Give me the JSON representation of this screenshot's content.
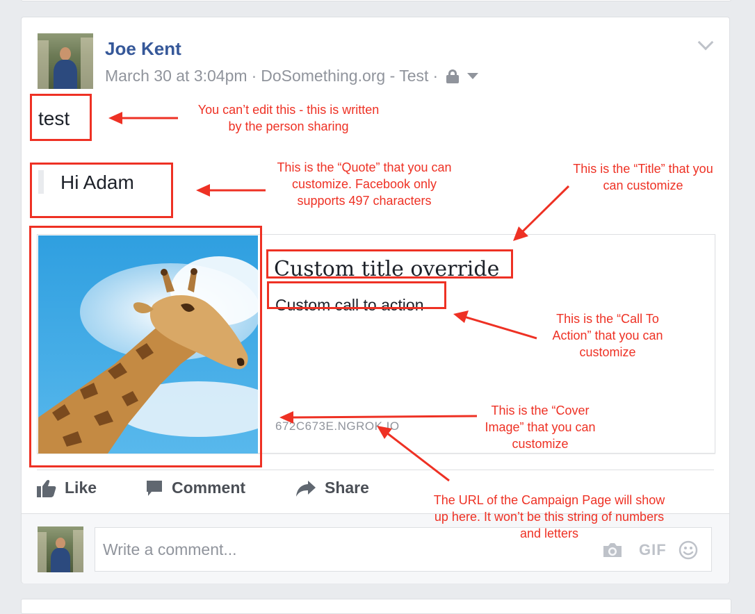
{
  "post": {
    "author": "Joe Kent",
    "meta": {
      "timestamp": "March 30 at 3:04pm",
      "separator": "·",
      "app": "DoSomething.org - Test",
      "separator2": "·"
    },
    "text": "test",
    "quote": "Hi Adam",
    "link_preview": {
      "title": "Custom title override",
      "call_to_action": "Custom call to action",
      "url": "672C673E.NGROK.IO"
    },
    "actions": [
      {
        "label": "Like",
        "icon": "thumbs-up-icon"
      },
      {
        "label": "Comment",
        "icon": "speech-bubble-icon"
      },
      {
        "label": "Share",
        "icon": "share-arrow-icon"
      }
    ],
    "comment": {
      "placeholder": "Write a comment...",
      "tools": [
        "camera-icon",
        "gif-icon",
        "emoji-icon"
      ],
      "gif_label": "GIF"
    }
  },
  "annotations": {
    "post_text": "You can’t edit this - this is written by the person sharing",
    "quote": "This is the “Quote” that you can customize. Facebook only supports 497 characters",
    "title": "This is the “Title” that you can customize",
    "cta": "This is the “Call To Action” that you can customize",
    "cover": "This is the “Cover Image” that you can customize",
    "url": "The URL of the Campaign Page will show up here. It won’t be this string of numbers and letters"
  },
  "colors": {
    "background": "#e9ebee",
    "author_link": "#365899",
    "meta_text": "#90949c",
    "action_text": "#4b4f56",
    "annotation": "#ee3124"
  }
}
